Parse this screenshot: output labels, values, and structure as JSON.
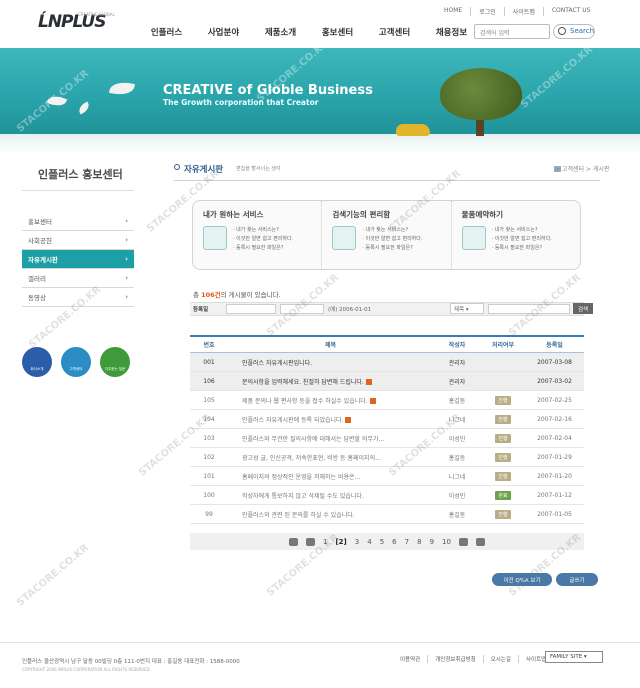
{
  "header": {
    "logo": "ĹNPLUS",
    "logo_sub": "CREATIVE GLOBAL",
    "top_links": [
      "HOME",
      "로그인",
      "사이트맵",
      "CONTACT US"
    ],
    "gnb": [
      "인플러스",
      "사업분야",
      "제품소개",
      "홍보센터",
      "고객센터",
      "채용정보"
    ],
    "search_placeholder": "검색어 입력",
    "search_label": "Search"
  },
  "banner": {
    "title": "CREATIVE of Globle Business",
    "subtitle": "The Growth corporation that Creator"
  },
  "sidebar": {
    "title": "인플러스 홍보센터",
    "items": [
      {
        "label": "홍보센터",
        "active": false
      },
      {
        "label": "사회공헌",
        "active": false
      },
      {
        "label": "자유게시판",
        "active": true
      },
      {
        "label": "갤러리",
        "active": false
      },
      {
        "label": "동영상",
        "active": false
      }
    ],
    "quick": [
      {
        "label": "회사소개",
        "color": "#2a5ea8"
      },
      {
        "label": "고객센터",
        "color": "#2a8ec4"
      },
      {
        "label": "자주묻는 질문",
        "color": "#3f9a3a"
      }
    ]
  },
  "content": {
    "title": "자유게시판",
    "desc": "편집을 할서너는 생각",
    "breadcrumb": "> 고객센터 > 게시판",
    "services": [
      {
        "title": "내가 원하는 서비스",
        "lines": [
          "· 내가 찾는 서비스는?",
          "· 이것만 알면 쉽고 편리하다.",
          "· 등록시 필요한 파일은?"
        ]
      },
      {
        "title": "검색기능의 편리함",
        "lines": [
          "· 내가 찾는 서비스는?",
          "· 이것만 알면 쉽고 편리하다.",
          "· 등록시 필요한 파일은?"
        ]
      },
      {
        "title": "물품예약하기",
        "lines": [
          "· 내가 찾는 서비스는?",
          "· 이것만 알면 쉽고 편리하다.",
          "· 등록시 필요한 파일은?"
        ]
      }
    ],
    "count_prefix": "총",
    "count": "106건",
    "count_suffix": "의 게시물이 있습니다.",
    "search_row": {
      "register_label": "등록일",
      "date_example": "(예) 2006-01-01",
      "select_value": "제목",
      "button": "검색"
    },
    "columns": [
      "번호",
      "제목",
      "작성자",
      "처리여부",
      "등록일"
    ],
    "rows": [
      {
        "no": "001",
        "subject": "인플러스 자유게시판입니다.",
        "author": "관리자",
        "status": "",
        "date": "2007-03-08",
        "notice": true,
        "new": false
      },
      {
        "no": "106",
        "subject": "문의사항을 입력해세요. 친절히 답변해 드립니다.",
        "author": "관리자",
        "status": "",
        "date": "2007-03-02",
        "notice": true,
        "new": true
      },
      {
        "no": "105",
        "subject": "제품 문의나 웹 편사항 등을 접수 하실수 있습니다.",
        "author": "홍길동",
        "status": "진행",
        "date": "2007-02-25",
        "notice": false,
        "new": true
      },
      {
        "no": "104",
        "subject": "인플러스 자유게시판에 등록 되었습니다.",
        "author": "니그네",
        "status": "진행",
        "date": "2007-02-16",
        "notice": false,
        "new": true
      },
      {
        "no": "103",
        "subject": "인플러스와 무관한 질의사항에 대해서는 답변할 의무가...",
        "author": "이성민",
        "status": "진행",
        "date": "2007-02-04",
        "notice": false,
        "new": false
      },
      {
        "no": "102",
        "subject": "광고성 글, 인신공격, 저속한표현, 비방 등 홈페이지의...",
        "author": "홍길동",
        "status": "진행",
        "date": "2007-01-29",
        "notice": false,
        "new": false
      },
      {
        "no": "101",
        "subject": "홈페이지의 정상적인 운영을 저해하는 비용은...",
        "author": "니그네",
        "status": "진행",
        "date": "2007-01-20",
        "notice": false,
        "new": false
      },
      {
        "no": "100",
        "subject": "작성자에게 통보하지 않고 삭제될 수도 있습니다.",
        "author": "이성민",
        "status": "완료",
        "date": "2007-01-12",
        "notice": false,
        "new": false
      },
      {
        "no": "99",
        "subject": "인플러스와 관련 된 문의를 하실 수 있습니다.",
        "author": "홍길동",
        "status": "진행",
        "date": "2007-01-05",
        "notice": false,
        "new": false
      }
    ],
    "pages": [
      "1",
      "[2]",
      "3",
      "4",
      "5",
      "6",
      "7",
      "8",
      "9",
      "10"
    ],
    "current_page": "[2]",
    "btn_qna": "이전 Q%A 보기",
    "btn_write": "글쓰기"
  },
  "footer": {
    "address": "인플러스 울산광역시 남구 달동 00빌딩 0층 111-0번지   대표 : 홍길동   대표전화 : 1588-0000",
    "copyright": "COPYRIGHT 2006 INPLUS CORPORATION ALL RIGHTS RESERVED",
    "links": [
      "이용약관",
      "개인정보취급방침",
      "오시는길",
      "사이트맵"
    ],
    "family_site": "FAMILY SITE"
  },
  "watermark": "STACORE.CO.KR"
}
